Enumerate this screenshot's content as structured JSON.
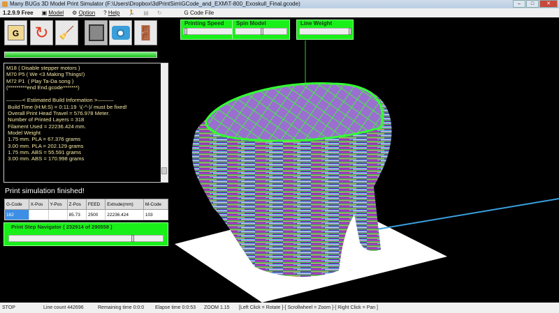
{
  "window": {
    "title": "Many BUGs 3D Model Print Simulator (F:\\Users\\Dropbox\\3dPrintSim\\GCode_and_EXM\\T-800_Exoskull_Final.gcode)"
  },
  "menu": {
    "version": "1.2.9.9 Free",
    "items": [
      "Model",
      "Option",
      "Help"
    ],
    "gcode_file": "G Code File"
  },
  "toolbar": {
    "buttons": [
      "open-gcode",
      "restart",
      "clear",
      "printer",
      "screenshot",
      "exit"
    ],
    "open_label": "G",
    "progress_percent": 100
  },
  "sliders": [
    {
      "label": "Printing Speed",
      "value": 0.02
    },
    {
      "label": "Spin Model",
      "value": 0.5
    },
    {
      "label": "Line Weight",
      "value": 0.97
    }
  ],
  "log": {
    "lines": [
      "M18 ( Disable stepper motors )",
      "M70 P5 ( We <3 Making Things!)",
      "M72 P1  ( Play Ta-Da song )",
      "(*********end End.gcode*******)",
      "",
      "———< Estimated Build Information >———",
      " Build Time (H:M:S) = 0:11:19  \\(-^-)/ must be fixed!",
      " Overall Print Head Travel = 576.978 Meter.",
      " Number of Printed Layers = 318",
      " Filament Used = 22236.424 mm.",
      " Model Weight",
      " 1.75 mm. PLA = 67.376 grams",
      " 3.00 mm. PLA = 202.129 grams",
      " 1.75 mm. ABS = 55.591 grams",
      " 3.00 mm. ABS = 170.998 grams"
    ]
  },
  "status_message": "Print simulation finished!",
  "table": {
    "headers": [
      "G-Code",
      "X-Pos",
      "Y-Pos",
      "Z-Pos",
      "FEED",
      "Extrude(mm)",
      "M-Code"
    ],
    "row": [
      "162",
      "",
      "",
      "85.73",
      "2500",
      "22236.424",
      "103"
    ]
  },
  "navigator": {
    "label": "Print Step Navigator  ( 232914 of 290558 )",
    "current": 232914,
    "total": 290558
  },
  "statusbar": {
    "state": "STOP",
    "line_count": "Line count  442696",
    "remaining": "Remaining time  0:0:0",
    "elapsed": "Elapse time  0:0:53",
    "zoom": "ZOOM 1.15",
    "hint": "[Left Click = Rotate ]-[ Scrollwheel = Zoom ]-[ Right Click = Pan ]"
  }
}
